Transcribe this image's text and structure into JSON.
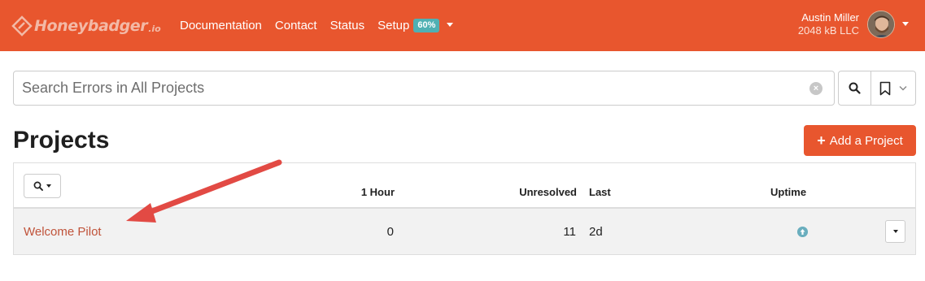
{
  "navbar": {
    "brand": "Honeybadger",
    "brand_tld": ".io",
    "links": [
      "Documentation",
      "Contact",
      "Status",
      "Setup"
    ],
    "setup_badge": "60%",
    "user": {
      "name": "Austin Miller",
      "org": "2048 kB LLC"
    },
    "colors": {
      "bar": "#e8562e",
      "badge": "#4fb0b3"
    }
  },
  "search": {
    "placeholder": "Search Errors in All Projects",
    "value": ""
  },
  "page": {
    "title": "Projects",
    "add_button": "Add a Project"
  },
  "table": {
    "columns": {
      "hour": "1 Hour",
      "unresolved": "Unresolved",
      "last": "Last",
      "uptime": "Uptime"
    },
    "rows": [
      {
        "project": "Welcome Pilot",
        "hour": "0",
        "unresolved": "11",
        "last": "2d",
        "uptime_status": "up"
      }
    ]
  },
  "icons": {
    "logo": "honeybadger-logo-icon",
    "clear": "clear-circle-icon",
    "search": "search-icon",
    "bookmark": "bookmark-icon",
    "plus": "plus-icon",
    "uptime": "up-arrow-circle-icon"
  },
  "annotation": {
    "color": "#e24a44"
  }
}
